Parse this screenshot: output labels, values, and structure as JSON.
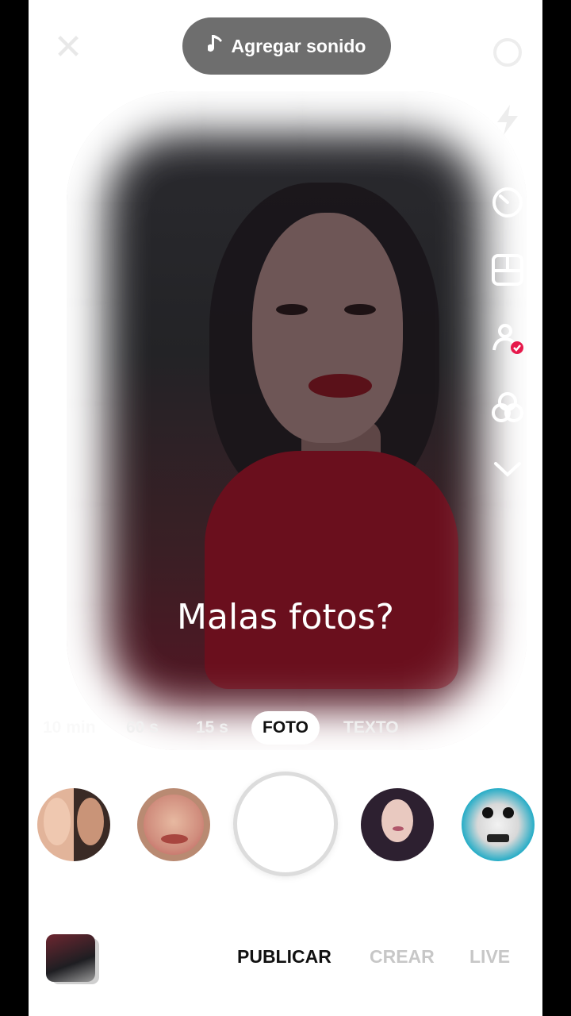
{
  "top_bar": {
    "sound_button_label": "Agregar sonido"
  },
  "right_tools": [
    "flip-camera-icon",
    "flash-icon",
    "timer-icon",
    "layout-icon",
    "effects-person-icon",
    "filters-icon",
    "more-chevron-icon"
  ],
  "preview": {
    "caption": "Malas fotos?"
  },
  "capture_modes": [
    {
      "label": "10 min",
      "active": false
    },
    {
      "label": "60 s",
      "active": false
    },
    {
      "label": "15 s",
      "active": false
    },
    {
      "label": "FOTO",
      "active": true
    },
    {
      "label": "TEXTO",
      "active": false
    }
  ],
  "effects": [
    "face-split-effect",
    "lips-effect",
    "hair-effect",
    "skull-effect"
  ],
  "bottom_nav": {
    "publish": "PUBLICAR",
    "create": "CREAR",
    "live": "LIVE"
  },
  "colors": {
    "sound_pill": "#6e6e6e",
    "nav_active": "#111111",
    "nav_inactive": "#c7c7c7",
    "badge": "#e6194b"
  }
}
